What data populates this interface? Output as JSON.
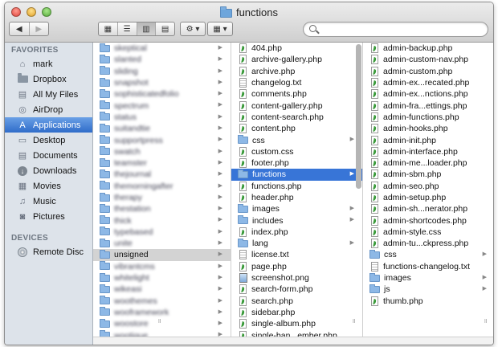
{
  "window": {
    "title": "functions"
  },
  "toolbar": {
    "back_icon": "chevron-left-icon",
    "forward_icon": "chevron-right-icon",
    "view_icons": [
      "icon-view-icon",
      "list-view-icon",
      "column-view-icon",
      "cover-flow-icon"
    ],
    "action_icon": "gear-icon",
    "arrange_icon": "arrange-grid-icon",
    "search_placeholder": ""
  },
  "sidebar": {
    "favorites_label": "FAVORITES",
    "devices_label": "DEVICES",
    "favorites": [
      {
        "label": "mark",
        "icon": "home-icon"
      },
      {
        "label": "Dropbox",
        "icon": "folder-icon"
      },
      {
        "label": "All My Files",
        "icon": "all-files-icon"
      },
      {
        "label": "AirDrop",
        "icon": "airdrop-icon"
      },
      {
        "label": "Applications",
        "icon": "applications-icon",
        "selected": true
      },
      {
        "label": "Desktop",
        "icon": "desktop-icon"
      },
      {
        "label": "Documents",
        "icon": "documents-icon"
      },
      {
        "label": "Downloads",
        "icon": "downloads-icon"
      },
      {
        "label": "Movies",
        "icon": "movies-icon"
      },
      {
        "label": "Music",
        "icon": "music-icon"
      },
      {
        "label": "Pictures",
        "icon": "pictures-icon"
      }
    ],
    "devices": [
      {
        "label": "Remote Disc",
        "icon": "disc-icon"
      }
    ]
  },
  "column1": {
    "blurred_items": [
      "skeptical",
      "slanted",
      "sliding",
      "snapshot",
      "sophisticatedfolio",
      "spectrum",
      "status",
      "suitandtie",
      "supportpress",
      "swatch",
      "teamster",
      "thejournal",
      "themorningafter",
      "therapy",
      "thestation",
      "thick",
      "typebased",
      "unite"
    ],
    "selected_item": "unsigned",
    "blurred_items_after": [
      "vibrantcms",
      "whitelight",
      "wikeasi",
      "woothemes",
      "wooframework",
      "woostore",
      "wootique",
      "wootube"
    ]
  },
  "column2": {
    "items": [
      {
        "name": "404.php",
        "type": "php"
      },
      {
        "name": "archive-gallery.php",
        "type": "php"
      },
      {
        "name": "archive.php",
        "type": "php"
      },
      {
        "name": "changelog.txt",
        "type": "doc"
      },
      {
        "name": "comments.php",
        "type": "php"
      },
      {
        "name": "content-gallery.php",
        "type": "php"
      },
      {
        "name": "content-search.php",
        "type": "php"
      },
      {
        "name": "content.php",
        "type": "php"
      },
      {
        "name": "css",
        "type": "folder"
      },
      {
        "name": "custom.css",
        "type": "php"
      },
      {
        "name": "footer.php",
        "type": "php"
      },
      {
        "name": "functions",
        "type": "folder",
        "selected": true
      },
      {
        "name": "functions.php",
        "type": "php"
      },
      {
        "name": "header.php",
        "type": "php"
      },
      {
        "name": "images",
        "type": "folder"
      },
      {
        "name": "includes",
        "type": "folder"
      },
      {
        "name": "index.php",
        "type": "php"
      },
      {
        "name": "lang",
        "type": "folder"
      },
      {
        "name": "license.txt",
        "type": "doc"
      },
      {
        "name": "page.php",
        "type": "php"
      },
      {
        "name": "screenshot.png",
        "type": "img"
      },
      {
        "name": "search-form.php",
        "type": "php"
      },
      {
        "name": "search.php",
        "type": "php"
      },
      {
        "name": "sidebar.php",
        "type": "php"
      },
      {
        "name": "single-album.php",
        "type": "php"
      },
      {
        "name": "single-ban...ember.php",
        "type": "php"
      }
    ]
  },
  "column3": {
    "items": [
      {
        "name": "admin-backup.php",
        "type": "php"
      },
      {
        "name": "admin-custom-nav.php",
        "type": "php"
      },
      {
        "name": "admin-custom.php",
        "type": "php"
      },
      {
        "name": "admin-ex...recated.php",
        "type": "php"
      },
      {
        "name": "admin-ex...nctions.php",
        "type": "php"
      },
      {
        "name": "admin-fra...ettings.php",
        "type": "php"
      },
      {
        "name": "admin-functions.php",
        "type": "php"
      },
      {
        "name": "admin-hooks.php",
        "type": "php"
      },
      {
        "name": "admin-init.php",
        "type": "php"
      },
      {
        "name": "admin-interface.php",
        "type": "php"
      },
      {
        "name": "admin-me...loader.php",
        "type": "php"
      },
      {
        "name": "admin-sbm.php",
        "type": "php"
      },
      {
        "name": "admin-seo.php",
        "type": "php"
      },
      {
        "name": "admin-setup.php",
        "type": "php"
      },
      {
        "name": "admin-sh...nerator.php",
        "type": "php"
      },
      {
        "name": "admin-shortcodes.php",
        "type": "php"
      },
      {
        "name": "admin-style.css",
        "type": "php"
      },
      {
        "name": "admin-tu...ckpress.php",
        "type": "php"
      },
      {
        "name": "css",
        "type": "folder"
      },
      {
        "name": "functions-changelog.txt",
        "type": "doc"
      },
      {
        "name": "images",
        "type": "folder"
      },
      {
        "name": "js",
        "type": "folder"
      },
      {
        "name": "thumb.php",
        "type": "php"
      }
    ]
  },
  "colors": {
    "sidebar_bg": "#dde3ea",
    "selection_blue": "#3875d7",
    "selection_gray": "#d3d3d3"
  }
}
